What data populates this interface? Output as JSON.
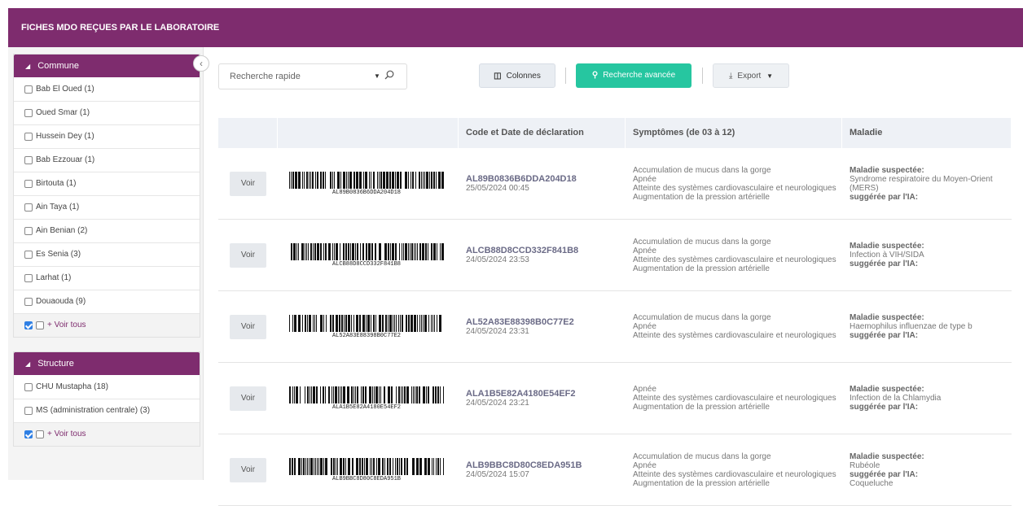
{
  "header": {
    "title": "FICHES MDO REÇUES PAR LE LABORATOIRE"
  },
  "sidebar": {
    "commune": {
      "title": "Commune",
      "items": [
        {
          "label": "Bab El Oued  (1)"
        },
        {
          "label": "Oued Smar  (1)"
        },
        {
          "label": "Hussein Dey  (1)"
        },
        {
          "label": "Bab Ezzouar  (1)"
        },
        {
          "label": "Birtouta  (1)"
        },
        {
          "label": "Ain Taya  (1)"
        },
        {
          "label": "Ain Benian  (2)"
        },
        {
          "label": "Es Senia  (3)"
        },
        {
          "label": "Larhat  (1)"
        },
        {
          "label": "Douaouda  (9)"
        }
      ],
      "voir_tous": "+ Voir tous"
    },
    "structure": {
      "title": "Structure",
      "items": [
        {
          "label": "CHU Mustapha  (18)"
        },
        {
          "label": "MS (administration centrale)  (3)"
        }
      ],
      "voir_tous": "+ Voir tous"
    }
  },
  "toolbar": {
    "search_placeholder": "Recherche rapide",
    "colonnes": "Colonnes",
    "recherche_avancee": "Recherche avancée",
    "export": "Export"
  },
  "table": {
    "headers": [
      "",
      "",
      "Code et Date de déclaration",
      "Symptômes (de 03 à 12)",
      "Maladie"
    ],
    "voir_label": "Voir",
    "maladie_label": "Maladie suspectée:",
    "ia_label": "suggérée par l'IA:",
    "rows": [
      {
        "code": "AL89B0836B6DDA204D18",
        "barcode_text": "AL89B0836B6DDA204D18",
        "date": "25/05/2024 00:45",
        "symptoms": [
          "Accumulation de mucus dans la gorge",
          "Apnée",
          "Atteinte des systèmes cardiovasculaire et neurologiques",
          "Augmentation de la pression artérielle"
        ],
        "maladie": "Syndrome respiratoire du Moyen-Orient (MERS)",
        "ia": ""
      },
      {
        "code": "ALCB88D8CCD332F841B8",
        "barcode_text": "ALCB88D8CCD332F841B8",
        "date": "24/05/2024 23:53",
        "symptoms": [
          "Accumulation de mucus dans la gorge",
          "Apnée",
          "Atteinte des systèmes cardiovasculaire et neurologiques",
          "Augmentation de la pression artérielle"
        ],
        "maladie": "Infection à VIH/SIDA",
        "ia": ""
      },
      {
        "code": "AL52A83E88398B0C77E2",
        "barcode_text": "AL52A83E88398B0C77E2",
        "date": "24/05/2024 23:31",
        "symptoms": [
          "Accumulation de mucus dans la gorge",
          "Apnée",
          "Atteinte des systèmes cardiovasculaire et neurologiques"
        ],
        "maladie": "Haemophilus influenzae de type b",
        "ia": ""
      },
      {
        "code": "ALA1B5E82A4180E54EF2",
        "barcode_text": "ALA1B5E82A4180E54EF2",
        "date": "24/05/2024 23:21",
        "symptoms": [
          "Apnée",
          "Atteinte des systèmes cardiovasculaire et neurologiques",
          "Augmentation de la pression artérielle"
        ],
        "maladie": "Infection de la Chlamydia",
        "ia": ""
      },
      {
        "code": "ALB9BBC8D80C8EDA951B",
        "barcode_text": "ALB9BBC8D80C8EDA951B",
        "date": "24/05/2024 15:07",
        "symptoms": [
          "Accumulation de mucus dans la gorge",
          "Apnée",
          "Atteinte des systèmes cardiovasculaire et neurologiques",
          "Augmentation de la pression artérielle"
        ],
        "maladie": "Rubéole",
        "ia": "Coqueluche"
      }
    ]
  }
}
